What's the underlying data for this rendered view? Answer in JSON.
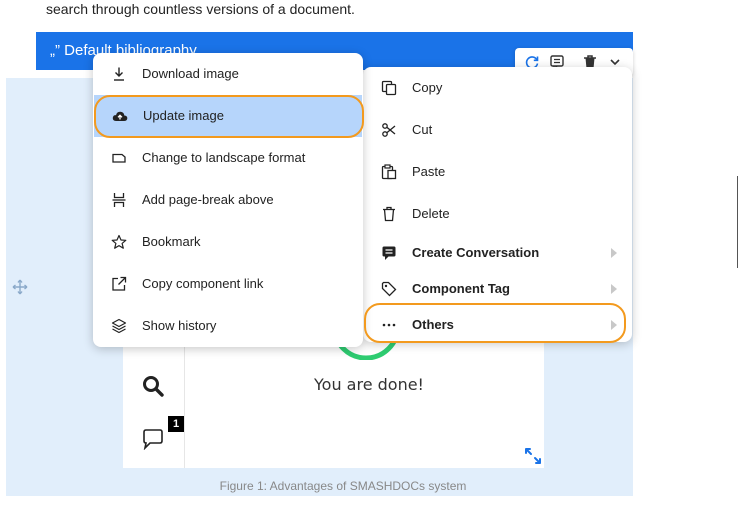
{
  "intro_text": "search through countless versions of a document.",
  "bibliography": {
    "quote_glyph": "„”",
    "title": "Default bibliography"
  },
  "figure": {
    "done_text": "You are done!",
    "comment_count": "1",
    "caption": "Figure 1: Advantages of SMASHDOCs system"
  },
  "toolbar": {
    "icons": [
      "refresh-icon",
      "comment-icon",
      "trash-icon",
      "chevron-down-icon"
    ]
  },
  "image_menu": {
    "items": [
      {
        "label": "Download image",
        "icon": "download-icon"
      },
      {
        "label": "Update image",
        "icon": "cloud-upload-icon",
        "selected": true
      },
      {
        "label": "Change to landscape format",
        "icon": "landscape-icon"
      },
      {
        "label": "Add page-break above",
        "icon": "page-break-icon"
      },
      {
        "label": "Bookmark",
        "icon": "star-icon"
      },
      {
        "label": "Copy component link",
        "icon": "external-link-icon"
      },
      {
        "label": "Show history",
        "icon": "layers-icon"
      }
    ]
  },
  "context_menu": {
    "items": [
      {
        "label": "Copy",
        "icon": "copy-icon"
      },
      {
        "label": "Cut",
        "icon": "scissors-icon"
      },
      {
        "label": "Paste",
        "icon": "paste-icon"
      },
      {
        "label": "Delete",
        "icon": "trash-icon"
      },
      {
        "label": "Create Conversation",
        "icon": "comment-icon",
        "submenu": true
      },
      {
        "label": "Component Tag",
        "icon": "tag-icon",
        "submenu": true
      },
      {
        "label": "Others",
        "icon": "more-icon",
        "submenu": true
      }
    ]
  },
  "colors": {
    "accent_blue": "#1a73e8",
    "selection": "#b6d5fb",
    "highlight_orange": "#f39a1e",
    "figure_background": "#e1eefb",
    "success_green": "#2ecc71"
  }
}
